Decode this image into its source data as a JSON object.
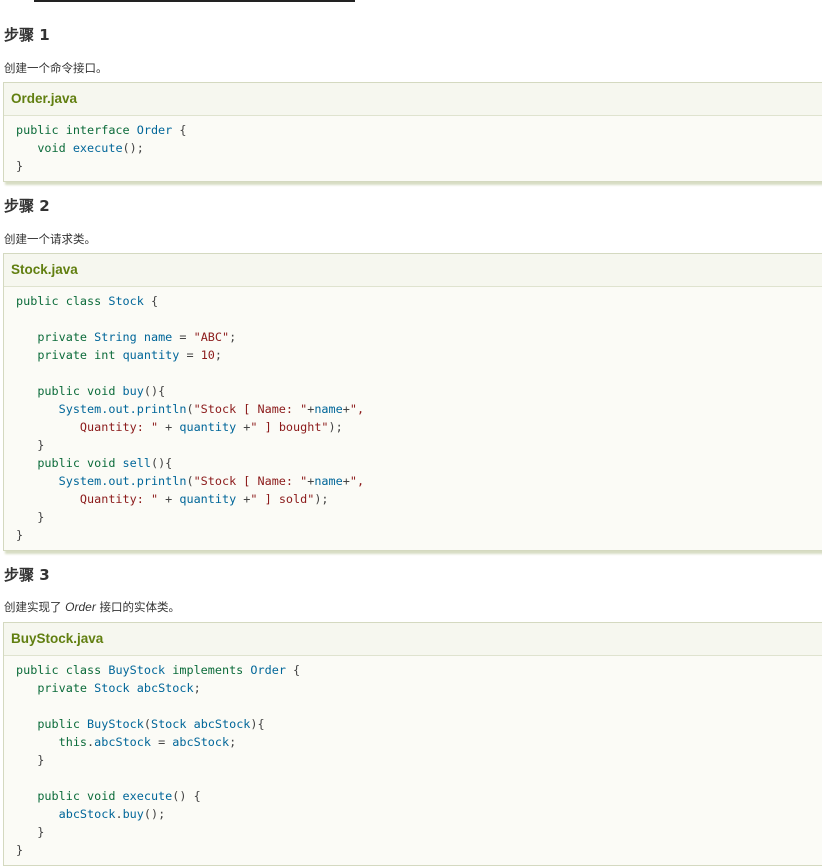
{
  "steps": [
    {
      "heading": "步骤 1",
      "desc_text": "创建一个命令接口。",
      "file": "Order.java",
      "code": [
        [
          [
            "k",
            "public "
          ],
          [
            "k",
            "interface "
          ],
          [
            "t",
            "Order "
          ],
          [
            "p",
            "{"
          ]
        ],
        [
          [
            "p",
            "   "
          ],
          [
            "k",
            "void "
          ],
          [
            "t",
            "execute"
          ],
          [
            "p",
            "();"
          ]
        ],
        [
          [
            "p",
            "}"
          ]
        ]
      ]
    },
    {
      "heading": "步骤 2",
      "desc_text": "创建一个请求类。",
      "file": "Stock.java",
      "code": [
        [
          [
            "k",
            "public "
          ],
          [
            "k",
            "class "
          ],
          [
            "t",
            "Stock "
          ],
          [
            "p",
            "{"
          ]
        ],
        [
          [
            "p",
            ""
          ]
        ],
        [
          [
            "p",
            "   "
          ],
          [
            "k",
            "private "
          ],
          [
            "t",
            "String "
          ],
          [
            "t",
            "name "
          ],
          [
            "p",
            "= "
          ],
          [
            "s",
            "\"ABC\""
          ],
          [
            "p",
            ";"
          ]
        ],
        [
          [
            "p",
            "   "
          ],
          [
            "k",
            "private "
          ],
          [
            "k",
            "int "
          ],
          [
            "t",
            "quantity "
          ],
          [
            "p",
            "= "
          ],
          [
            "n",
            "10"
          ],
          [
            "p",
            ";"
          ]
        ],
        [
          [
            "p",
            ""
          ]
        ],
        [
          [
            "p",
            "   "
          ],
          [
            "k",
            "public "
          ],
          [
            "k",
            "void "
          ],
          [
            "t",
            "buy"
          ],
          [
            "p",
            "(){"
          ]
        ],
        [
          [
            "p",
            "      "
          ],
          [
            "t",
            "System.out.println"
          ],
          [
            "p",
            "("
          ],
          [
            "s",
            "\"Stock [ Name: \""
          ],
          [
            "p",
            "+"
          ],
          [
            "t",
            "name"
          ],
          [
            "p",
            "+"
          ],
          [
            "s",
            "\","
          ]
        ],
        [
          [
            "s",
            "         Quantity: \" "
          ],
          [
            "p",
            "+ "
          ],
          [
            "t",
            "quantity "
          ],
          [
            "p",
            "+"
          ],
          [
            "s",
            "\" ] bought\""
          ],
          [
            "p",
            ");"
          ]
        ],
        [
          [
            "p",
            "   }"
          ]
        ],
        [
          [
            "p",
            "   "
          ],
          [
            "k",
            "public "
          ],
          [
            "k",
            "void "
          ],
          [
            "t",
            "sell"
          ],
          [
            "p",
            "(){"
          ]
        ],
        [
          [
            "p",
            "      "
          ],
          [
            "t",
            "System.out.println"
          ],
          [
            "p",
            "("
          ],
          [
            "s",
            "\"Stock [ Name: \""
          ],
          [
            "p",
            "+"
          ],
          [
            "t",
            "name"
          ],
          [
            "p",
            "+"
          ],
          [
            "s",
            "\","
          ]
        ],
        [
          [
            "s",
            "         Quantity: \" "
          ],
          [
            "p",
            "+ "
          ],
          [
            "t",
            "quantity "
          ],
          [
            "p",
            "+"
          ],
          [
            "s",
            "\" ] sold\""
          ],
          [
            "p",
            ");"
          ]
        ],
        [
          [
            "p",
            "   }"
          ]
        ],
        [
          [
            "p",
            "}"
          ]
        ]
      ]
    },
    {
      "heading": "步骤 3",
      "desc_before": "创建实现了 ",
      "desc_em": "Order",
      "desc_after": " 接口的实体类。",
      "file": "BuyStock.java",
      "code": [
        [
          [
            "k",
            "public "
          ],
          [
            "k",
            "class "
          ],
          [
            "t",
            "BuyStock "
          ],
          [
            "k",
            "implements "
          ],
          [
            "t",
            "Order "
          ],
          [
            "p",
            "{"
          ]
        ],
        [
          [
            "p",
            "   "
          ],
          [
            "k",
            "private "
          ],
          [
            "t",
            "Stock "
          ],
          [
            "t",
            "abcStock"
          ],
          [
            "p",
            ";"
          ]
        ],
        [
          [
            "p",
            ""
          ]
        ],
        [
          [
            "p",
            "   "
          ],
          [
            "k",
            "public "
          ],
          [
            "t",
            "BuyStock"
          ],
          [
            "p",
            "("
          ],
          [
            "t",
            "Stock "
          ],
          [
            "t",
            "abcStock"
          ],
          [
            "p",
            "){"
          ]
        ],
        [
          [
            "p",
            "      "
          ],
          [
            "k",
            "this"
          ],
          [
            "p",
            "."
          ],
          [
            "t",
            "abcStock "
          ],
          [
            "p",
            "= "
          ],
          [
            "t",
            "abcStock"
          ],
          [
            "p",
            ";"
          ]
        ],
        [
          [
            "p",
            "   }"
          ]
        ],
        [
          [
            "p",
            ""
          ]
        ],
        [
          [
            "p",
            "   "
          ],
          [
            "k",
            "public "
          ],
          [
            "k",
            "void "
          ],
          [
            "t",
            "execute"
          ],
          [
            "p",
            "() {"
          ]
        ],
        [
          [
            "p",
            "      "
          ],
          [
            "t",
            "abcStock"
          ],
          [
            "p",
            "."
          ],
          [
            "t",
            "buy"
          ],
          [
            "p",
            "();"
          ]
        ],
        [
          [
            "p",
            "   }"
          ]
        ],
        [
          [
            "p",
            "}"
          ]
        ]
      ]
    }
  ],
  "colors": {
    "file_title": "#617f10",
    "keyword": "#0b6b3a",
    "type": "#006699",
    "string": "#8b1a1a"
  }
}
